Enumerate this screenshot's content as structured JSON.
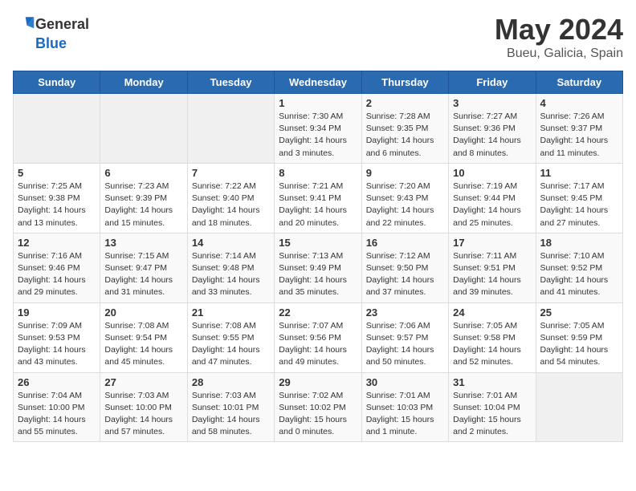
{
  "header": {
    "logo_general": "General",
    "logo_blue": "Blue",
    "title": "May 2024",
    "subtitle": "Bueu, Galicia, Spain"
  },
  "weekdays": [
    "Sunday",
    "Monday",
    "Tuesday",
    "Wednesday",
    "Thursday",
    "Friday",
    "Saturday"
  ],
  "weeks": [
    [
      {
        "day": "",
        "info": ""
      },
      {
        "day": "",
        "info": ""
      },
      {
        "day": "",
        "info": ""
      },
      {
        "day": "1",
        "info": "Sunrise: 7:30 AM\nSunset: 9:34 PM\nDaylight: 14 hours\nand 3 minutes."
      },
      {
        "day": "2",
        "info": "Sunrise: 7:28 AM\nSunset: 9:35 PM\nDaylight: 14 hours\nand 6 minutes."
      },
      {
        "day": "3",
        "info": "Sunrise: 7:27 AM\nSunset: 9:36 PM\nDaylight: 14 hours\nand 8 minutes."
      },
      {
        "day": "4",
        "info": "Sunrise: 7:26 AM\nSunset: 9:37 PM\nDaylight: 14 hours\nand 11 minutes."
      }
    ],
    [
      {
        "day": "5",
        "info": "Sunrise: 7:25 AM\nSunset: 9:38 PM\nDaylight: 14 hours\nand 13 minutes."
      },
      {
        "day": "6",
        "info": "Sunrise: 7:23 AM\nSunset: 9:39 PM\nDaylight: 14 hours\nand 15 minutes."
      },
      {
        "day": "7",
        "info": "Sunrise: 7:22 AM\nSunset: 9:40 PM\nDaylight: 14 hours\nand 18 minutes."
      },
      {
        "day": "8",
        "info": "Sunrise: 7:21 AM\nSunset: 9:41 PM\nDaylight: 14 hours\nand 20 minutes."
      },
      {
        "day": "9",
        "info": "Sunrise: 7:20 AM\nSunset: 9:43 PM\nDaylight: 14 hours\nand 22 minutes."
      },
      {
        "day": "10",
        "info": "Sunrise: 7:19 AM\nSunset: 9:44 PM\nDaylight: 14 hours\nand 25 minutes."
      },
      {
        "day": "11",
        "info": "Sunrise: 7:17 AM\nSunset: 9:45 PM\nDaylight: 14 hours\nand 27 minutes."
      }
    ],
    [
      {
        "day": "12",
        "info": "Sunrise: 7:16 AM\nSunset: 9:46 PM\nDaylight: 14 hours\nand 29 minutes."
      },
      {
        "day": "13",
        "info": "Sunrise: 7:15 AM\nSunset: 9:47 PM\nDaylight: 14 hours\nand 31 minutes."
      },
      {
        "day": "14",
        "info": "Sunrise: 7:14 AM\nSunset: 9:48 PM\nDaylight: 14 hours\nand 33 minutes."
      },
      {
        "day": "15",
        "info": "Sunrise: 7:13 AM\nSunset: 9:49 PM\nDaylight: 14 hours\nand 35 minutes."
      },
      {
        "day": "16",
        "info": "Sunrise: 7:12 AM\nSunset: 9:50 PM\nDaylight: 14 hours\nand 37 minutes."
      },
      {
        "day": "17",
        "info": "Sunrise: 7:11 AM\nSunset: 9:51 PM\nDaylight: 14 hours\nand 39 minutes."
      },
      {
        "day": "18",
        "info": "Sunrise: 7:10 AM\nSunset: 9:52 PM\nDaylight: 14 hours\nand 41 minutes."
      }
    ],
    [
      {
        "day": "19",
        "info": "Sunrise: 7:09 AM\nSunset: 9:53 PM\nDaylight: 14 hours\nand 43 minutes."
      },
      {
        "day": "20",
        "info": "Sunrise: 7:08 AM\nSunset: 9:54 PM\nDaylight: 14 hours\nand 45 minutes."
      },
      {
        "day": "21",
        "info": "Sunrise: 7:08 AM\nSunset: 9:55 PM\nDaylight: 14 hours\nand 47 minutes."
      },
      {
        "day": "22",
        "info": "Sunrise: 7:07 AM\nSunset: 9:56 PM\nDaylight: 14 hours\nand 49 minutes."
      },
      {
        "day": "23",
        "info": "Sunrise: 7:06 AM\nSunset: 9:57 PM\nDaylight: 14 hours\nand 50 minutes."
      },
      {
        "day": "24",
        "info": "Sunrise: 7:05 AM\nSunset: 9:58 PM\nDaylight: 14 hours\nand 52 minutes."
      },
      {
        "day": "25",
        "info": "Sunrise: 7:05 AM\nSunset: 9:59 PM\nDaylight: 14 hours\nand 54 minutes."
      }
    ],
    [
      {
        "day": "26",
        "info": "Sunrise: 7:04 AM\nSunset: 10:00 PM\nDaylight: 14 hours\nand 55 minutes."
      },
      {
        "day": "27",
        "info": "Sunrise: 7:03 AM\nSunset: 10:00 PM\nDaylight: 14 hours\nand 57 minutes."
      },
      {
        "day": "28",
        "info": "Sunrise: 7:03 AM\nSunset: 10:01 PM\nDaylight: 14 hours\nand 58 minutes."
      },
      {
        "day": "29",
        "info": "Sunrise: 7:02 AM\nSunset: 10:02 PM\nDaylight: 15 hours\nand 0 minutes."
      },
      {
        "day": "30",
        "info": "Sunrise: 7:01 AM\nSunset: 10:03 PM\nDaylight: 15 hours\nand 1 minute."
      },
      {
        "day": "31",
        "info": "Sunrise: 7:01 AM\nSunset: 10:04 PM\nDaylight: 15 hours\nand 2 minutes."
      },
      {
        "day": "",
        "info": ""
      }
    ]
  ]
}
